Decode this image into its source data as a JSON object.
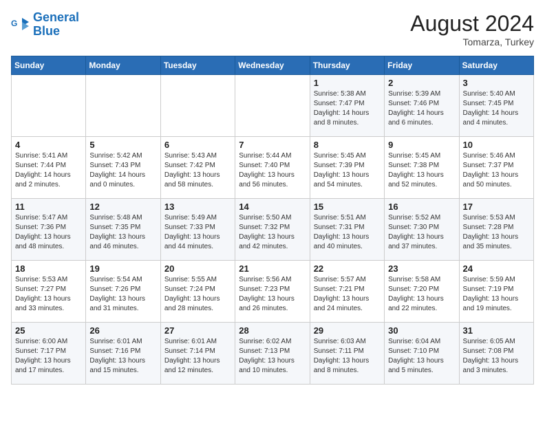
{
  "header": {
    "logo_line1": "General",
    "logo_line2": "Blue",
    "month_year": "August 2024",
    "location": "Tomarza, Turkey"
  },
  "weekdays": [
    "Sunday",
    "Monday",
    "Tuesday",
    "Wednesday",
    "Thursday",
    "Friday",
    "Saturday"
  ],
  "weeks": [
    [
      {
        "day": "",
        "info": ""
      },
      {
        "day": "",
        "info": ""
      },
      {
        "day": "",
        "info": ""
      },
      {
        "day": "",
        "info": ""
      },
      {
        "day": "1",
        "info": "Sunrise: 5:38 AM\nSunset: 7:47 PM\nDaylight: 14 hours\nand 8 minutes."
      },
      {
        "day": "2",
        "info": "Sunrise: 5:39 AM\nSunset: 7:46 PM\nDaylight: 14 hours\nand 6 minutes."
      },
      {
        "day": "3",
        "info": "Sunrise: 5:40 AM\nSunset: 7:45 PM\nDaylight: 14 hours\nand 4 minutes."
      }
    ],
    [
      {
        "day": "4",
        "info": "Sunrise: 5:41 AM\nSunset: 7:44 PM\nDaylight: 14 hours\nand 2 minutes."
      },
      {
        "day": "5",
        "info": "Sunrise: 5:42 AM\nSunset: 7:43 PM\nDaylight: 14 hours\nand 0 minutes."
      },
      {
        "day": "6",
        "info": "Sunrise: 5:43 AM\nSunset: 7:42 PM\nDaylight: 13 hours\nand 58 minutes."
      },
      {
        "day": "7",
        "info": "Sunrise: 5:44 AM\nSunset: 7:40 PM\nDaylight: 13 hours\nand 56 minutes."
      },
      {
        "day": "8",
        "info": "Sunrise: 5:45 AM\nSunset: 7:39 PM\nDaylight: 13 hours\nand 54 minutes."
      },
      {
        "day": "9",
        "info": "Sunrise: 5:45 AM\nSunset: 7:38 PM\nDaylight: 13 hours\nand 52 minutes."
      },
      {
        "day": "10",
        "info": "Sunrise: 5:46 AM\nSunset: 7:37 PM\nDaylight: 13 hours\nand 50 minutes."
      }
    ],
    [
      {
        "day": "11",
        "info": "Sunrise: 5:47 AM\nSunset: 7:36 PM\nDaylight: 13 hours\nand 48 minutes."
      },
      {
        "day": "12",
        "info": "Sunrise: 5:48 AM\nSunset: 7:35 PM\nDaylight: 13 hours\nand 46 minutes."
      },
      {
        "day": "13",
        "info": "Sunrise: 5:49 AM\nSunset: 7:33 PM\nDaylight: 13 hours\nand 44 minutes."
      },
      {
        "day": "14",
        "info": "Sunrise: 5:50 AM\nSunset: 7:32 PM\nDaylight: 13 hours\nand 42 minutes."
      },
      {
        "day": "15",
        "info": "Sunrise: 5:51 AM\nSunset: 7:31 PM\nDaylight: 13 hours\nand 40 minutes."
      },
      {
        "day": "16",
        "info": "Sunrise: 5:52 AM\nSunset: 7:30 PM\nDaylight: 13 hours\nand 37 minutes."
      },
      {
        "day": "17",
        "info": "Sunrise: 5:53 AM\nSunset: 7:28 PM\nDaylight: 13 hours\nand 35 minutes."
      }
    ],
    [
      {
        "day": "18",
        "info": "Sunrise: 5:53 AM\nSunset: 7:27 PM\nDaylight: 13 hours\nand 33 minutes."
      },
      {
        "day": "19",
        "info": "Sunrise: 5:54 AM\nSunset: 7:26 PM\nDaylight: 13 hours\nand 31 minutes."
      },
      {
        "day": "20",
        "info": "Sunrise: 5:55 AM\nSunset: 7:24 PM\nDaylight: 13 hours\nand 28 minutes."
      },
      {
        "day": "21",
        "info": "Sunrise: 5:56 AM\nSunset: 7:23 PM\nDaylight: 13 hours\nand 26 minutes."
      },
      {
        "day": "22",
        "info": "Sunrise: 5:57 AM\nSunset: 7:21 PM\nDaylight: 13 hours\nand 24 minutes."
      },
      {
        "day": "23",
        "info": "Sunrise: 5:58 AM\nSunset: 7:20 PM\nDaylight: 13 hours\nand 22 minutes."
      },
      {
        "day": "24",
        "info": "Sunrise: 5:59 AM\nSunset: 7:19 PM\nDaylight: 13 hours\nand 19 minutes."
      }
    ],
    [
      {
        "day": "25",
        "info": "Sunrise: 6:00 AM\nSunset: 7:17 PM\nDaylight: 13 hours\nand 17 minutes."
      },
      {
        "day": "26",
        "info": "Sunrise: 6:01 AM\nSunset: 7:16 PM\nDaylight: 13 hours\nand 15 minutes."
      },
      {
        "day": "27",
        "info": "Sunrise: 6:01 AM\nSunset: 7:14 PM\nDaylight: 13 hours\nand 12 minutes."
      },
      {
        "day": "28",
        "info": "Sunrise: 6:02 AM\nSunset: 7:13 PM\nDaylight: 13 hours\nand 10 minutes."
      },
      {
        "day": "29",
        "info": "Sunrise: 6:03 AM\nSunset: 7:11 PM\nDaylight: 13 hours\nand 8 minutes."
      },
      {
        "day": "30",
        "info": "Sunrise: 6:04 AM\nSunset: 7:10 PM\nDaylight: 13 hours\nand 5 minutes."
      },
      {
        "day": "31",
        "info": "Sunrise: 6:05 AM\nSunset: 7:08 PM\nDaylight: 13 hours\nand 3 minutes."
      }
    ]
  ]
}
